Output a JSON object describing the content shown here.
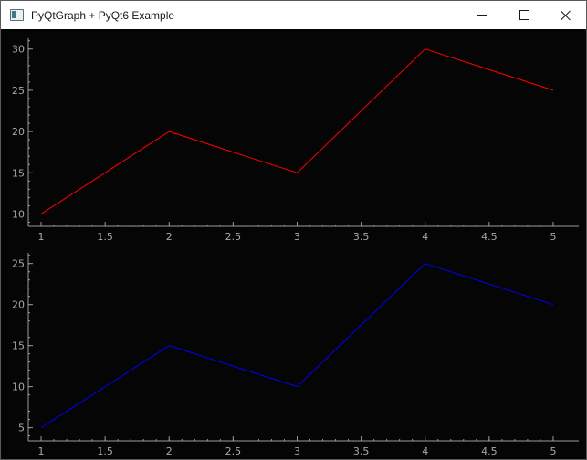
{
  "window": {
    "title": "PyQtGraph + PyQt6 Example",
    "icon": "app-window-icon",
    "controls": [
      "minimize-icon",
      "maximize-icon",
      "close-icon"
    ]
  },
  "colors": {
    "background": "#050505",
    "axis": "#9a9a9a",
    "tick_label": "#a8a8a8",
    "series_top": "#ff0000",
    "series_bottom": "#0000ff"
  },
  "chart_data": [
    {
      "type": "line",
      "x": [
        1,
        2,
        3,
        4,
        5
      ],
      "series": [
        {
          "values": [
            10,
            20,
            15,
            30,
            25
          ],
          "color": "#ff0000"
        }
      ],
      "xticks": [
        "1",
        "1.5",
        "2",
        "2.5",
        "3",
        "3.5",
        "4",
        "4.5",
        "5"
      ],
      "yticks": [
        "10",
        "15",
        "20",
        "25",
        "30"
      ],
      "xlim": [
        0.9,
        5.2
      ],
      "ylim": [
        8.5,
        31.3
      ],
      "grid": false
    },
    {
      "type": "line",
      "x": [
        1,
        2,
        3,
        4,
        5
      ],
      "series": [
        {
          "values": [
            5,
            15,
            10,
            25,
            20
          ],
          "color": "#0000ff"
        }
      ],
      "xticks": [
        "1",
        "1.5",
        "2",
        "2.5",
        "3",
        "3.5",
        "4",
        "4.5",
        "5"
      ],
      "yticks": [
        "5",
        "10",
        "15",
        "20",
        "25"
      ],
      "xlim": [
        0.9,
        5.2
      ],
      "ylim": [
        3.4,
        26.3
      ],
      "grid": false
    }
  ]
}
